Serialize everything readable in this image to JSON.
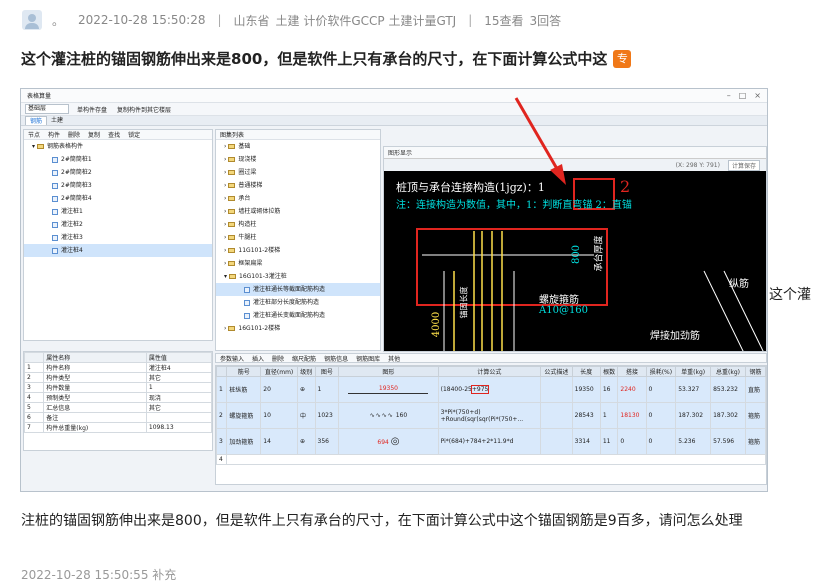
{
  "question": {
    "username": "。",
    "datetime": "2022-10-28 15:50:28",
    "location": "山东省",
    "tags": "土建 计价软件GCCP 土建计量GTJ",
    "views": "15查看",
    "answers": "3回答",
    "title": "这个灌注桩的锚固钢筋伸出来是800，但是软件上只有承台的尺寸，在下面计算公式中这",
    "badge": "专",
    "overflow_fragment": "这个灌"
  },
  "screenshot": {
    "window_title": "表格算量",
    "floor_select": "基础层",
    "toolbar": [
      "单构件存盘",
      "复制构件到其它楼层"
    ],
    "tabs": [
      "钢筋",
      "土建"
    ],
    "left_toolbar": [
      "节点",
      "构件",
      "删除",
      "复制",
      "查找",
      "锁定"
    ],
    "tree_root": "钢筋表格构件",
    "tree_items": [
      "2#筒筒桩1",
      "2#筒筒桩2",
      "2#筒筒桩3",
      "2#筒筒桩4",
      "灌注桩1",
      "灌注桩2",
      "灌注桩3",
      "灌注桩4"
    ],
    "gallery_title": "图集列表",
    "gallery_items": [
      "基础",
      "现浇楼",
      "圈过梁",
      "普通楼梯",
      "承台",
      "墙柱或砌体拉筋",
      "构造柱",
      "牛腿柱",
      "11G101-2楼梯",
      "框架扁梁",
      "16G101-3灌注桩"
    ],
    "gallery_subitems": [
      "灌注桩通长等截面配筋构造",
      "灌注桩部分长度配筋构造",
      "灌注桩通长变截面配筋构造"
    ],
    "gallery_last": "16G101-2楼梯",
    "props": {
      "header": [
        "属性名称",
        "属性值"
      ],
      "rows": [
        [
          "1",
          "构件名称",
          "灌注桩4"
        ],
        [
          "2",
          "构件类型",
          "其它"
        ],
        [
          "3",
          "构件数量",
          "1"
        ],
        [
          "4",
          "预制类型",
          "现浇"
        ],
        [
          "5",
          "汇总信息",
          "其它"
        ],
        [
          "6",
          "备注",
          ""
        ],
        [
          "7",
          "构件总重量(kg)",
          "1098.13"
        ]
      ]
    },
    "graphic": {
      "panel_title": "图形显示",
      "coords": "(X: 298 Y: 791)",
      "calc_button": "计算保存",
      "line1": "桩顶与承台连接构造(1jgz)：1",
      "annotation_num": "2",
      "line2": "注：连接构造为数值，其中，1：判断直弯锚    2：直锚",
      "dim_800": "800",
      "cap_label": "承台厚度",
      "spiral_label": "螺旋箍筋",
      "spiral_value": "A10@160",
      "longbar_label": "纵筋",
      "weld_label": "焊接加劲筋",
      "dim_4000": "4000",
      "anchor_label": "锚固长度"
    },
    "grid_toolbar": [
      "参数输入",
      "插入",
      "删除",
      "缩尺配筋",
      "钢筋信息",
      "钢筋图库",
      "其他"
    ],
    "grid": {
      "headers": [
        "筋号",
        "直径(mm)",
        "级别",
        "图号",
        "图形",
        "计算公式",
        "公式描述",
        "长度",
        "根数",
        "搭接",
        "损耗(%)",
        "单重(kg)",
        "总重(kg)",
        "钢筋"
      ],
      "rows": [
        {
          "no": "1",
          "name": "桩纵筋",
          "dia": "20",
          "grade": "⊕",
          "fig": "1",
          "shape_value": "19350",
          "formula_a": "(18400-25",
          "formula_b": "+975",
          "desc": "",
          "length": "19350",
          "count": "16",
          "lap": "2240",
          "loss": "0",
          "unit": "53.327",
          "total": "853.232",
          "kind": "直筋"
        },
        {
          "no": "2",
          "name": "螺旋箍筋",
          "dia": "10",
          "grade": "中",
          "fig": "1023",
          "shape_value": "160",
          "formula_a": "3*Pi*(750+d)",
          "formula_b": "+Round(sqr(sqr(Pi*(750+...",
          "desc": "",
          "length": "28543",
          "count": "1",
          "lap": "18130",
          "loss": "0",
          "unit": "187.302",
          "total": "187.302",
          "kind": "箍筋"
        },
        {
          "no": "3",
          "name": "加劲箍筋",
          "dia": "14",
          "grade": "⊕",
          "fig": "356",
          "shape_value": "694",
          "formula_a": "Pi*(684)+784+2*11.9*d",
          "formula_b": "",
          "desc": "",
          "length": "3314",
          "count": "11",
          "lap": "0",
          "loss": "0",
          "unit": "5.236",
          "total": "57.596",
          "kind": "箍筋"
        },
        {
          "no": "4",
          "name": "",
          "dia": "",
          "grade": "",
          "fig": "",
          "shape_value": "",
          "formula_a": "",
          "formula_b": "",
          "desc": "",
          "length": "",
          "count": "",
          "lap": "",
          "loss": "",
          "unit": "",
          "total": "",
          "kind": ""
        }
      ]
    }
  },
  "answer_text": "注桩的锚固钢筋伸出来是800，但是软件上只有承台的尺寸，在下面计算公式中这个锚固钢筋是9百多，请问怎么处理",
  "bottom_meta": "2022-10-28 15:50:55 补充",
  "colors": {
    "accent_red": "#e0251f",
    "badge": "#f07818",
    "cad_yellow": "#ffe14a",
    "cad_cyan": "#00e0e0"
  }
}
